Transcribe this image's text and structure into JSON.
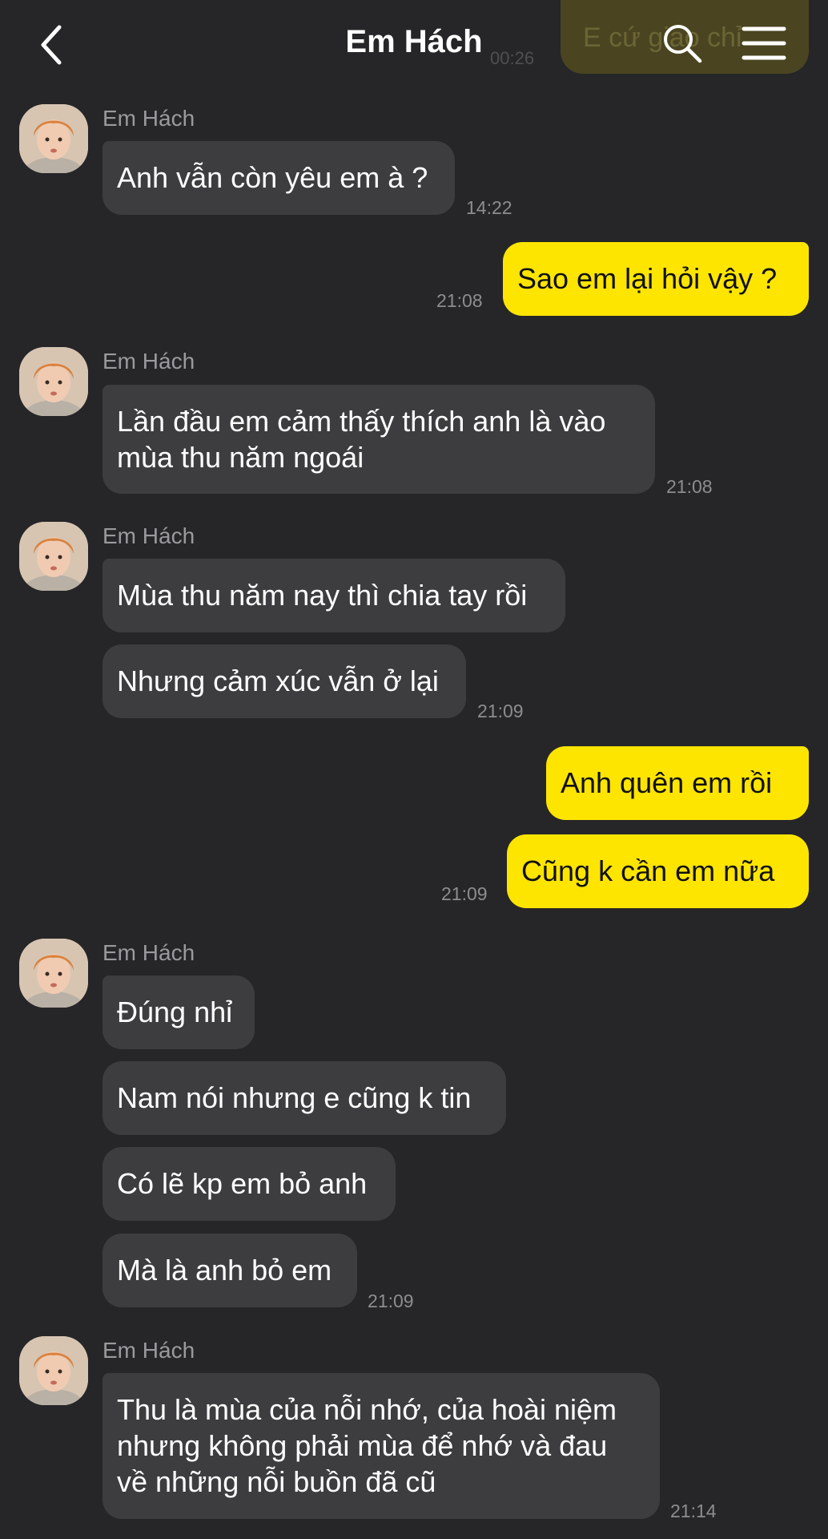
{
  "header": {
    "title": "Em Hách",
    "ghost_text": "E cứ giao chỉ",
    "ghost_time": "00:26"
  },
  "contact_name": "Em Hách",
  "messages": [
    {
      "text": "Anh vẫn còn yêu em à ?",
      "time": "14:22"
    },
    {
      "text": "Sao em lại hỏi vậy ?",
      "time": "21:08"
    },
    {
      "text": "Lần đầu em cảm thấy thích anh là vào mùa thu năm ngoái",
      "time": "21:08"
    },
    {
      "text": "Mùa thu năm nay thì chia tay rồi"
    },
    {
      "text": "Nhưng cảm xúc vẫn ở lại",
      "time": "21:09"
    },
    {
      "text": "Anh quên em rồi"
    },
    {
      "text": "Cũng k cần em nữa",
      "time": "21:09"
    },
    {
      "text": "Đúng nhỉ"
    },
    {
      "text": "Nam nói nhưng e cũng k tin"
    },
    {
      "text": "Có lẽ kp em bỏ anh"
    },
    {
      "text": "Mà là anh bỏ em",
      "time": "21:09"
    },
    {
      "text": "Thu là mùa của nỗi nhớ, của hoài niệm nhưng không phải mùa để nhớ và đau về những nỗi buồn đã cũ",
      "time": "21:14"
    }
  ],
  "colors": {
    "background": "#262628",
    "incoming_bubble": "#3d3d40",
    "outgoing_bubble": "#fee500",
    "timestamp": "#8d8d91"
  },
  "icons": [
    "back-arrow-icon",
    "search-icon",
    "menu-icon"
  ]
}
